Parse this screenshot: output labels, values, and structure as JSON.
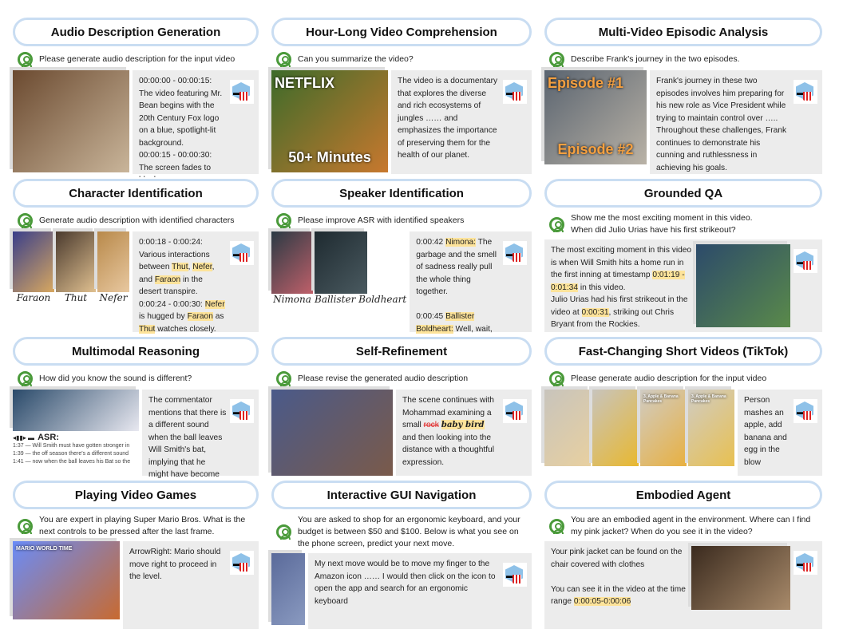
{
  "panels": [
    {
      "title": "Audio Description Generation",
      "prompt": "Please generate audio description for the input video",
      "images": [
        {
          "w": 146,
          "h": 128,
          "c1": "#6b4a30",
          "c2": "#c9b59a",
          "label": ""
        }
      ],
      "response": [
        {
          "t": "00:00:00 - 00:00:15: The video featuring Mr. Bean begins with the 20th Century Fox logo on a blue, spotlight-lit background.\n00:00:15 - 00:00:30: The screen fades to black …."
        }
      ]
    },
    {
      "title": "Hour-Long Video Comprehension",
      "prompt": "Can you summarize the video?",
      "images": [
        {
          "w": 146,
          "h": 128,
          "c1": "#3d6b2a",
          "c2": "#c8782e",
          "label": "50+ Minutes",
          "top": "NETFLIX"
        }
      ],
      "response": [
        {
          "t": "The video is a documentary that explores the diverse and rich ecosystems of jungles …… and emphasizes the importance of preserving them for the health of our planet."
        }
      ]
    },
    {
      "title": "Multi-Video Episodic Analysis",
      "prompt": "Describe Frank's journey in the two episodes.",
      "images": [
        {
          "w": 128,
          "h": 118,
          "c1": "#5a6470",
          "c2": "#b9b2a6",
          "label": "Episode #2",
          "top": "Episode #1"
        }
      ],
      "response": [
        {
          "t": "Frank's journey in these two episodes involves him preparing for his new role as Vice President while trying to maintain control over ….. Throughout these challenges, Frank continues to demonstrate his cunning and ruthlessness in achieving his goals."
        }
      ]
    },
    {
      "title": "Character Identification",
      "prompt": "Generate audio description with identified characters",
      "images": [
        {
          "w": 52,
          "h": 76,
          "c1": "#3a3f8a",
          "c2": "#d8a860",
          "label": "",
          "cap": "Faraon"
        },
        {
          "w": 50,
          "h": 76,
          "c1": "#4a3a2e",
          "c2": "#e0c090",
          "label": "",
          "cap": "Thut"
        },
        {
          "w": 40,
          "h": 76,
          "c1": "#b8894a",
          "c2": "#e8c8a0",
          "label": "",
          "cap": "Nefer"
        }
      ],
      "response": [
        {
          "t": "0:00:18 - 0:00:24:\nVarious interactions between "
        },
        {
          "t": "Thut",
          "hl": true
        },
        {
          "t": ", "
        },
        {
          "t": "Nefer",
          "hl": true
        },
        {
          "t": ",\nand "
        },
        {
          "t": "Faraon",
          "hl": true
        },
        {
          "t": " in the desert transpire.\n0:00:24 - 0:00:30: "
        },
        {
          "t": "Nefer",
          "hl": true
        },
        {
          "t": "\nis hugged by "
        },
        {
          "t": "Faraon",
          "hl": true
        },
        {
          "t": " as\n"
        },
        {
          "t": "Thut",
          "hl": true
        },
        {
          "t": " watches closely."
        }
      ]
    },
    {
      "title": "Speaker Identification",
      "prompt": "Please improve ASR with identified speakers",
      "images": [
        {
          "w": 52,
          "h": 78,
          "c1": "#2a3a44",
          "c2": "#c0606a",
          "label": "",
          "cap": "Nimona"
        },
        {
          "w": 66,
          "h": 78,
          "c1": "#1e2a30",
          "c2": "#4a5a60",
          "label": "",
          "cap": "Ballister Boldheart"
        }
      ],
      "response": [
        {
          "t": "0:00:42 "
        },
        {
          "t": "Nimona:",
          "hl": true
        },
        {
          "t": " The garbage and the smell of sadness really pull the whole thing together.\n\n0:00:45 "
        },
        {
          "t": "Ballister Boldheart:",
          "hl": true
        },
        {
          "t": " Well, wait, wait, wait. Who? Who are you?"
        }
      ]
    },
    {
      "title": "Grounded QA",
      "prompt": "Show me the most exciting moment in this video.\nWhen did Julio Urias have his first strikeout?",
      "inside": true,
      "images": [
        {
          "w": 118,
          "h": 108,
          "c1": "#2c4a6a",
          "c2": "#5a8a4a",
          "label": ""
        }
      ],
      "response": [
        {
          "t": "The most exciting moment in this video is when Will Smith hits a home run in the first inning at timestamp "
        },
        {
          "t": "0:01:19 - 0:01:34",
          "hl": true
        },
        {
          "t": " in this video.\nJulio Urias had his first strikeout in the video at "
        },
        {
          "t": "0:00:31",
          "hl": true
        },
        {
          "t": ", striking out Chris Bryant from the Rockies."
        }
      ]
    },
    {
      "title": "Multimodal Reasoning",
      "prompt": "How did you know the sound is different?",
      "images": [
        {
          "w": 158,
          "h": 52,
          "c1": "#2a4a6a",
          "c2": "#e8e8f0",
          "label": ""
        }
      ],
      "asr": {
        "label": "ASR:",
        "lines": [
          "1:37 — Will Smith must have gotten stronger in",
          "1:39 — the off season there's a different sound",
          "1:41 — now when the ball leaves his Bat so the"
        ]
      },
      "response": [
        {
          "t": "The commentator mentions that there is a different sound when the ball leaves Will Smith's bat, implying that he might have become stronger."
        }
      ]
    },
    {
      "title": "Self-Refinement",
      "prompt": "Please revise the generated audio description",
      "images": [
        {
          "w": 152,
          "h": 122,
          "c1": "#4a5a8a",
          "c2": "#7a5a4a",
          "label": ""
        }
      ],
      "response": [
        {
          "t": "The scene continues with Mohammad examining a small "
        },
        {
          "t": "rock",
          "strike": true
        },
        {
          "t": "   "
        },
        {
          "t": "baby bird",
          "hand": true
        },
        {
          "t": " and then looking into the distance with a thoughtful expression."
        }
      ]
    },
    {
      "title": "Fast-Changing Short Videos (TikTok)",
      "prompt": "Please generate audio description for the input video",
      "images": [
        {
          "w": 58,
          "h": 96,
          "c1": "#c8c4bc",
          "c2": "#e8d0a0",
          "label": ""
        },
        {
          "w": 58,
          "h": 96,
          "c1": "#c8c4bc",
          "c2": "#e8b830",
          "label": ""
        },
        {
          "w": 58,
          "h": 96,
          "c1": "#d0ccc4",
          "c2": "#e8b040",
          "label": "",
          "top": "3. Apple & Banana Pancakes"
        },
        {
          "w": 58,
          "h": 96,
          "c1": "#d0ccc4",
          "c2": "#e8c050",
          "label": "",
          "top": "3. Apple & Banana Pancakes"
        }
      ],
      "response": [
        {
          "t": "Person mashes an apple, add banana and egg in the blow"
        }
      ]
    },
    {
      "title": "Playing Video Games",
      "prompt": "You are expert in playing Super Mario Bros. What is the next controls to be pressed after the last frame.",
      "images": [
        {
          "w": 134,
          "h": 98,
          "c1": "#6a8cf8",
          "c2": "#c86a30",
          "label": "",
          "top": "MARIO  WORLD  TIME"
        }
      ],
      "response": [
        {
          "t": "ArrowRight: Mario should move right to proceed in the level."
        }
      ]
    },
    {
      "title": "Interactive GUI Navigation",
      "prompt": "You are asked to shop for an ergonomic keyboard, and your budget is between $50 and $100. Below is what you see on the phone  screen, predict your next move.",
      "images": [
        {
          "w": 42,
          "h": 90,
          "c1": "#5a6a9a",
          "c2": "#8a9ac0",
          "label": ""
        }
      ],
      "response": [
        {
          "t": "My next move would be to move my finger to the Amazon icon …… I would then click on the icon to open the app and search for an ergonomic keyboard"
        }
      ]
    },
    {
      "title": "Embodied Agent",
      "prompt": "You are an embodied agent in the environment. Where can I find my pink jacket? When do you see it in the video?",
      "inside": true,
      "images": [
        {
          "w": 124,
          "h": 80,
          "c1": "#3a2a1e",
          "c2": "#a88a6a",
          "label": ""
        }
      ],
      "response": [
        {
          "t": "Your pink jacket can be found on the chair covered with clothes\n\nYou can see it in the video at the time range "
        },
        {
          "t": "0:00:05-0:00:06",
          "hl": true
        }
      ]
    }
  ],
  "icons": {
    "user": "user-circle-icon",
    "model": "glasses-popcorn-icon"
  },
  "colors": {
    "title_border": "#c9ddf2",
    "response_bg": "#ececec",
    "highlight": "#fde39a",
    "user_icon": "#4a9a3a"
  }
}
